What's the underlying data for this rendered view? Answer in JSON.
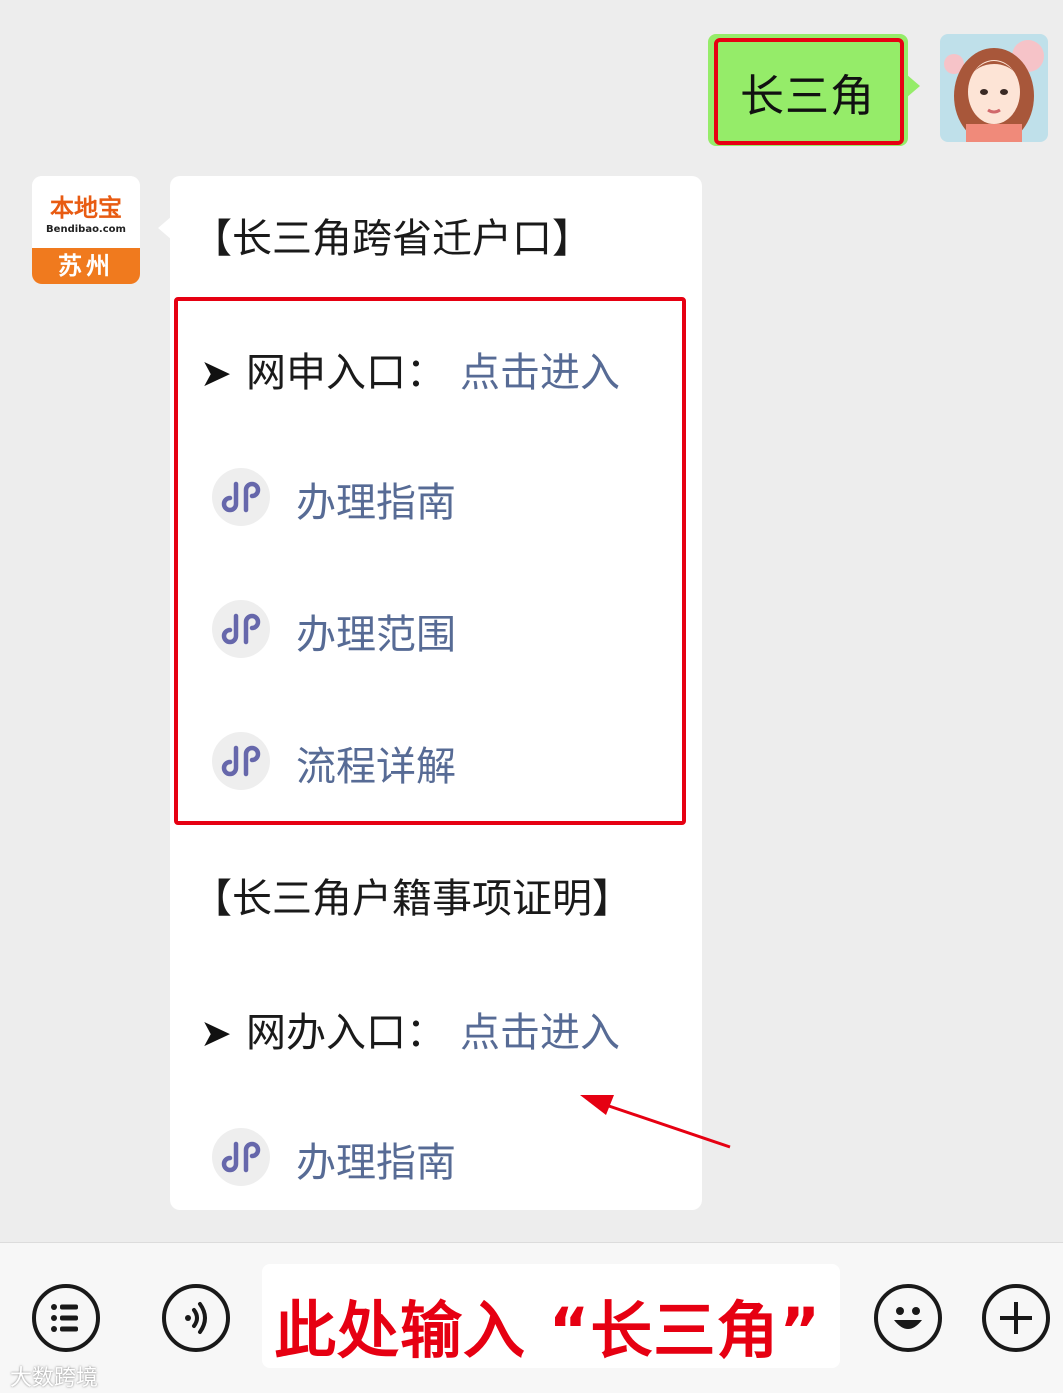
{
  "outgoing_message": {
    "text": "长三角"
  },
  "bot_avatar": {
    "logo_text": "本地宝",
    "logo_sub": "Bendibao.com",
    "city": "苏州"
  },
  "incoming_message": {
    "section1_title": "【长三角跨省迁户口】",
    "section1_entry_label": "网申入口：",
    "section1_entry_link": "点击进入",
    "section1_links": [
      "办理指南",
      "办理范围",
      "流程详解"
    ],
    "section2_title": "【长三角户籍事项证明】",
    "section2_entry_label": "网办入口：",
    "section2_entry_link": "点击进入",
    "section2_links": [
      "办理指南"
    ],
    "arrow_symbol": "➤"
  },
  "input_bar": {
    "input_text": "此处输入 “长三角”"
  },
  "watermark": {
    "text": "大数跨境"
  },
  "colors": {
    "chat_bg": "#ededed",
    "outgoing_bubble": "#95ec69",
    "link": "#576b95",
    "highlight_red": "#e60012",
    "brand_orange": "#f07a1e"
  },
  "icons": [
    "list-icon",
    "voice-icon",
    "emoji-icon",
    "plus-icon",
    "mini-program-link-icon"
  ]
}
